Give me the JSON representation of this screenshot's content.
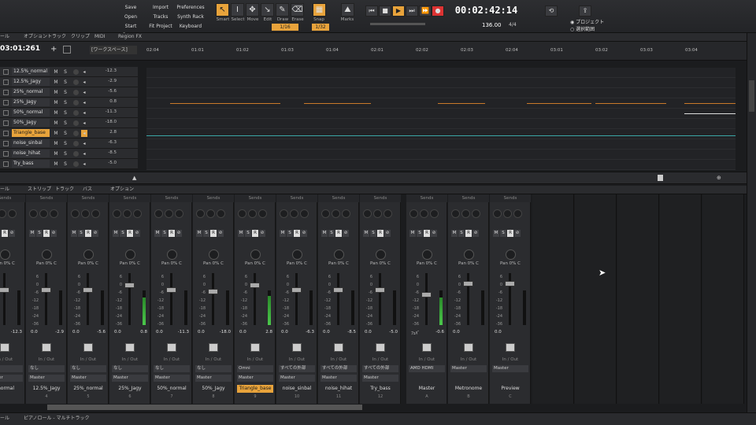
{
  "control_bar": {
    "file_buttons": [
      "Save",
      "Open",
      "Start Screen"
    ],
    "project_buttons": [
      "Import",
      "Tracks",
      "Fit Project"
    ],
    "pref_buttons": [
      "Preferences",
      "Synth Rack",
      "Keyboard"
    ],
    "tools": [
      {
        "label": "Smart",
        "icon": "smart-tool-icon",
        "glyph": "↖",
        "active": true
      },
      {
        "label": "Select",
        "icon": "select-tool-icon",
        "glyph": "I",
        "active": false
      },
      {
        "label": "Move",
        "icon": "move-tool-icon",
        "glyph": "✥",
        "active": false
      },
      {
        "label": "Edit",
        "icon": "edit-tool-icon",
        "glyph": "↘",
        "active": false
      },
      {
        "label": "Draw",
        "icon": "draw-tool-icon",
        "glyph": "✎",
        "active": false
      },
      {
        "label": "Erase",
        "icon": "erase-tool-icon",
        "glyph": "⌫",
        "active": false
      }
    ],
    "snap_label": "Snap",
    "snap_value": "1/16",
    "snap_value2": "1/32",
    "marks_label": "Marks",
    "time": "00:02:42:14",
    "tempo": "136.00",
    "time_sig": "4/4",
    "project_radio": "プロジェクト",
    "selection_radio": "選択範囲"
  },
  "menu_row": {
    "items": [
      "ール",
      "オプション",
      "トラック",
      "クリップ",
      "MIDI",
      "Region FX"
    ]
  },
  "track_header": {
    "now_time": "03:01:261",
    "workspace": "[ワークスペース]"
  },
  "ruler": [
    "02:04",
    "01:01",
    "01:02",
    "01:03",
    "01:04",
    "02:01",
    "02:02",
    "02:03",
    "02:04",
    "03:01",
    "03:02",
    "03:03",
    "03:04"
  ],
  "tracks": [
    {
      "name": "12.5%_normal",
      "value": "-12.3",
      "selected": false
    },
    {
      "name": "12.5%_Jagy",
      "value": "-2.9",
      "selected": false
    },
    {
      "name": "25%_normal",
      "value": "-5.6",
      "selected": false
    },
    {
      "name": "25%_Jagy",
      "value": "0.8",
      "selected": false
    },
    {
      "name": "50%_normal",
      "value": "-11.3",
      "selected": false
    },
    {
      "name": "50%_Jagy",
      "value": "-18.0",
      "selected": false
    },
    {
      "name": "Triangle_base",
      "value": "2.8",
      "selected": true
    },
    {
      "name": "noise_sinbal",
      "value": "-6.3",
      "selected": false
    },
    {
      "name": "noise_hihat",
      "value": "-8.5",
      "selected": false
    },
    {
      "name": "Try_bass",
      "value": "-5.0",
      "selected": false
    }
  ],
  "mixer_menu": {
    "items": [
      "ール",
      "ストリップ",
      "トラック",
      "バス",
      "オプション"
    ]
  },
  "mixer_strips": [
    {
      "name": "_normal",
      "num": "",
      "pan": "Pan 0% C",
      "left": "0.0",
      "right": "-12.3",
      "input": "なし",
      "output": "Master",
      "selected": false,
      "meter": 0
    },
    {
      "name": "12.5%_Jagy",
      "num": "4",
      "pan": "Pan 0% C",
      "left": "0.0",
      "right": "-2.9",
      "input": "なし",
      "output": "Master",
      "selected": false,
      "meter": 0
    },
    {
      "name": "25%_normal",
      "num": "5",
      "pan": "Pan 0% C",
      "left": "0.0",
      "right": "-5.6",
      "input": "なし",
      "output": "Master",
      "selected": false,
      "meter": 0
    },
    {
      "name": "25%_Jagy",
      "num": "6",
      "pan": "Pan 0% C",
      "left": "0.0",
      "right": "0.8",
      "input": "なし",
      "output": "Master",
      "selected": false,
      "meter": 0.8
    },
    {
      "name": "50%_normal",
      "num": "7",
      "pan": "Pan 0% C",
      "left": "0.0",
      "right": "-11.3",
      "input": "なし",
      "output": "Master",
      "selected": false,
      "meter": 0
    },
    {
      "name": "50%_Jagy",
      "num": "8",
      "pan": "Pan 0% C",
      "left": "0.0",
      "right": "-18.0",
      "input": "なし",
      "output": "Master",
      "selected": false,
      "meter": 0
    },
    {
      "name": "Triangle_base",
      "num": "9",
      "pan": "Pan 0% C",
      "left": "0.0",
      "right": "2.8",
      "input": "Omni",
      "output": "Master",
      "selected": true,
      "meter": 0.85
    },
    {
      "name": "noise_sinbal",
      "num": "10",
      "pan": "Pan 0% C",
      "left": "0.0",
      "right": "-6.3",
      "input": "すべての外部",
      "output": "Master",
      "selected": false,
      "meter": 0
    },
    {
      "name": "noise_hihat",
      "num": "11",
      "pan": "Pan 0% C",
      "left": "0.0",
      "right": "-8.5",
      "input": "すべての外部",
      "output": "Master",
      "selected": false,
      "meter": 0
    },
    {
      "name": "Try_bass",
      "num": "12",
      "pan": "Pan 0% C",
      "left": "0.0",
      "right": "-5.0",
      "input": "すべての外部",
      "output": "Master",
      "selected": false,
      "meter": 0
    },
    {
      "name": "Master",
      "num": "A",
      "pan": "Pan 0% C",
      "left": "ﾌｪﾊﾞ",
      "right": "-0.6",
      "input": "AMD HDMI",
      "output": "",
      "selected": false,
      "meter": 0.8
    },
    {
      "name": "Metronome",
      "num": "B",
      "pan": "Pan 0% C",
      "left": "0.0",
      "right": "",
      "input": "Master",
      "output": "",
      "selected": false,
      "meter": 0
    },
    {
      "name": "Preview",
      "num": "C",
      "pan": "Pan 0% C",
      "left": "0.0",
      "right": "",
      "input": "Master",
      "output": "",
      "selected": false,
      "meter": 0
    }
  ],
  "sends_label": "Sends",
  "io_label": "In / Out",
  "bottom_tabs": [
    "ール",
    "ピアノロール - マルチトラック"
  ],
  "colors": {
    "accent": "#e8a33b",
    "meter": "#4bc84b",
    "bg": "#1b1c1e"
  }
}
